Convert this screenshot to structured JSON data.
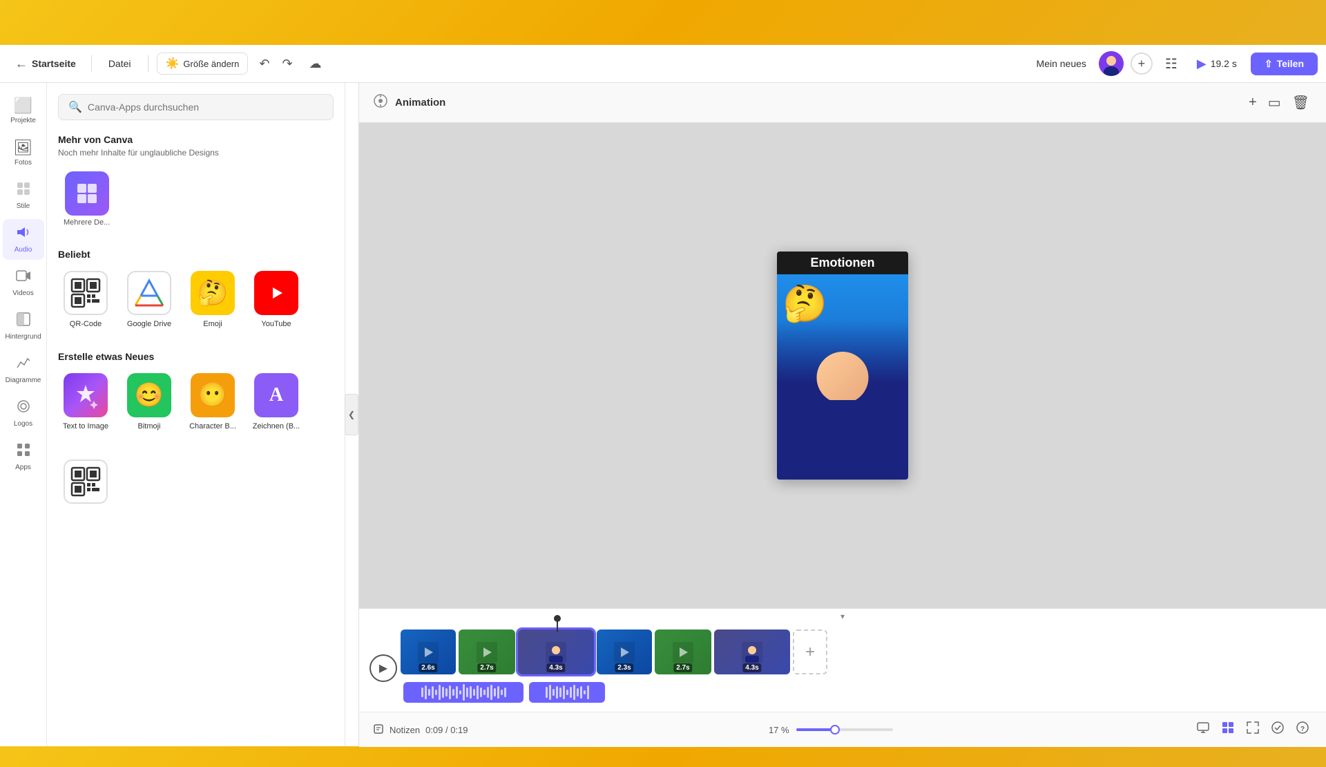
{
  "topBanner": {
    "bg": "#f5c518"
  },
  "toolbar": {
    "homeLabel": "Startseite",
    "fileLabel": "Datei",
    "sizeLabel": "Größe ändern",
    "sizeIcon": "☀️",
    "projectTitle": "Mein neues",
    "playTime": "19.2 s",
    "shareLabel": "Teilen",
    "addIcon": "+"
  },
  "sidebar": {
    "items": [
      {
        "id": "projekte",
        "icon": "⊞",
        "label": "Projekte"
      },
      {
        "id": "fotos",
        "icon": "🖼",
        "label": "Fotos"
      },
      {
        "id": "stile",
        "icon": "🎨",
        "label": "Stile"
      },
      {
        "id": "audio",
        "icon": "♪",
        "label": "Audio",
        "active": true
      },
      {
        "id": "videos",
        "icon": "▶",
        "label": "Videos"
      },
      {
        "id": "hintergrund",
        "icon": "◧",
        "label": "Hintergrund"
      },
      {
        "id": "diagramme",
        "icon": "📈",
        "label": "Diagramme"
      },
      {
        "id": "logos",
        "icon": "⭕",
        "label": "Logos"
      },
      {
        "id": "apps",
        "icon": "⊞",
        "label": "Apps"
      }
    ]
  },
  "appsPanel": {
    "searchPlaceholder": "Canva-Apps durchsuchen",
    "mehrVonCanva": {
      "title": "Mehr von Canva",
      "subtitle": "Noch mehr Inhalte für unglaubliche Designs",
      "items": [
        {
          "id": "mehrere-de",
          "label": "Mehrere De...",
          "icon": "⊡"
        }
      ]
    },
    "beliebt": {
      "title": "Beliebt",
      "apps": [
        {
          "id": "qr-code",
          "label": "QR-Code",
          "iconType": "qr",
          "symbol": "▦"
        },
        {
          "id": "google-drive",
          "label": "Google Drive",
          "iconType": "gdrive",
          "symbol": "▲"
        },
        {
          "id": "emoji",
          "label": "Emoji",
          "iconType": "emoji",
          "symbol": "🤔"
        },
        {
          "id": "youtube",
          "label": "YouTube",
          "iconType": "youtube",
          "symbol": "▶"
        }
      ]
    },
    "erstelleEtwasNeues": {
      "title": "Erstelle etwas Neues",
      "apps": [
        {
          "id": "text-to-image",
          "label": "Text to Image",
          "iconType": "text2img",
          "symbol": "✦"
        },
        {
          "id": "bitmoji",
          "label": "Bitmoji",
          "iconType": "bitmoji",
          "symbol": "😊"
        },
        {
          "id": "character-b",
          "label": "Character B...",
          "iconType": "charb",
          "symbol": "😶"
        },
        {
          "id": "zeichnen-b",
          "label": "Zeichnen (B...",
          "iconType": "zeichnen",
          "symbol": "A"
        }
      ]
    }
  },
  "canvas": {
    "animationLabel": "Animation",
    "videoTitle": "Emotionen",
    "emoji": "🤔"
  },
  "timeline": {
    "notesLabel": "Notizen",
    "currentTime": "0:09 / 0:19",
    "zoomLevel": "17 %",
    "clips": [
      {
        "id": "c1",
        "duration": "2.6s",
        "bg": "1"
      },
      {
        "id": "c2",
        "duration": "2.7s",
        "bg": "2"
      },
      {
        "id": "c3",
        "duration": "4.3s",
        "bg": "3",
        "selected": true
      },
      {
        "id": "c4",
        "duration": "2.3s",
        "bg": "1"
      },
      {
        "id": "c5",
        "duration": "2.7s",
        "bg": "2"
      },
      {
        "id": "c6",
        "duration": "4.3s",
        "bg": "3"
      }
    ]
  }
}
